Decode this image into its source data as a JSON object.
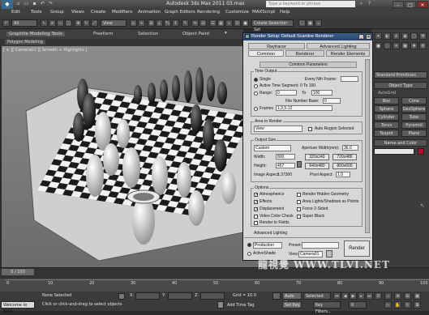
{
  "app": {
    "title": "Autodesk 3ds Max 2011    03.max",
    "search_placeholder": "Type a keyword or phrase",
    "menu": [
      "Edit",
      "Tools",
      "Group",
      "Views",
      "Create",
      "Modifiers",
      "Animation",
      "Graph Editors",
      "Rendering",
      "Customize",
      "MAXScript",
      "Help"
    ]
  },
  "toolbar": {
    "selection_filter": "All",
    "view_dropdown": "View",
    "named_selection": "Create Selection Set"
  },
  "ribbon": {
    "tabs": [
      "Graphite Modeling Tools",
      "Freeform",
      "Selection",
      "Object Paint"
    ],
    "subtab": "Polygon Modeling"
  },
  "viewport": {
    "label": "[ + ][ Camera01 ][ Smooth + Highlights ]"
  },
  "command_panel": {
    "category": "Standard Primitives",
    "object_type_header": "Object Type",
    "autogrid": "AutoGrid",
    "buttons": [
      "Box",
      "Cone",
      "Sphere",
      "GeoSphere",
      "Cylinder",
      "Tube",
      "Torus",
      "Pyramid",
      "Teapot",
      "Plane"
    ],
    "name_color_header": "Name and Color",
    "name_color_swatch": "#b0102a"
  },
  "render_dialog": {
    "title": "Render Setup: Default Scanline Renderer",
    "tabs_row1": [
      "Raytracer",
      "Advanced Lighting"
    ],
    "tabs_row2": [
      "Common",
      "Renderer",
      "Render Elements"
    ],
    "active_tab": "Common",
    "common_params_header": "Common Parameters",
    "time_output": {
      "header": "Time Output",
      "single": "Single",
      "every_nth": "Every Nth Frame:",
      "active_segment": "Active Time Segment:",
      "active_range": "0 To 100",
      "range": "Range:",
      "range_from": "0",
      "to": "To",
      "range_to": "100",
      "file_number_base": "File Number Base:",
      "file_number_value": "0",
      "frames": "Frames",
      "frames_value": "1,3,5-12"
    },
    "area_to_render": {
      "header": "Area to Render",
      "value": "View",
      "auto_region": "Auto Region Selected"
    },
    "output_size": {
      "header": "Output Size",
      "preset": "Custom",
      "aperture_label": "Aperture Width(mm):",
      "aperture_value": "36.0",
      "width_label": "Width:",
      "width_value": "800",
      "height_label": "Height:",
      "height_value": "457",
      "presets": [
        "320x240",
        "720x486",
        "640x480",
        "800x600"
      ],
      "image_aspect_label": "Image Aspect:",
      "image_aspect_value": "1.37300",
      "pixel_aspect_label": "Pixel Aspect:",
      "pixel_aspect_value": "1.0"
    },
    "options": {
      "header": "Options",
      "items": [
        {
          "label": "Atmospherics",
          "checked": true
        },
        {
          "label": "Render Hidden Geometry",
          "checked": false
        },
        {
          "label": "Effects",
          "checked": true
        },
        {
          "label": "Area Lights/Shadows as Points",
          "checked": false
        },
        {
          "label": "Displacement",
          "checked": true
        },
        {
          "label": "Force 2-Sided",
          "checked": false
        },
        {
          "label": "Video Color Check",
          "checked": false
        },
        {
          "label": "Super Black",
          "checked": false
        },
        {
          "label": "Render to Fields",
          "checked": false
        }
      ]
    },
    "advanced_lighting_header": "Advanced Lighting",
    "bottom": {
      "production": "Production",
      "activeshade": "ActiveShade",
      "preset_label": "Preset:",
      "view_label": "View:",
      "view_value": "Camera01",
      "render_button": "Render"
    }
  },
  "timeline": {
    "slider": "0 / 100",
    "ticks": [
      "0",
      "10",
      "20",
      "30",
      "40",
      "50",
      "60",
      "70",
      "80",
      "90",
      "100"
    ]
  },
  "status": {
    "welcome": "Welcome to MAX",
    "none_selected": "None Selected",
    "prompt": "Click or click-and-drag to select objects",
    "x_label": "X:",
    "y_label": "Y:",
    "z_label": "Z:",
    "grid": "Grid = 10.0",
    "auto_key": "Auto Key",
    "selected": "Selected",
    "set_key": "Set Key",
    "key_filters": "Key Filters...",
    "add_time_tag": "Add Time Tag",
    "frame": "0"
  },
  "watermark": "龍視覺 WWW.TLVI.NET"
}
